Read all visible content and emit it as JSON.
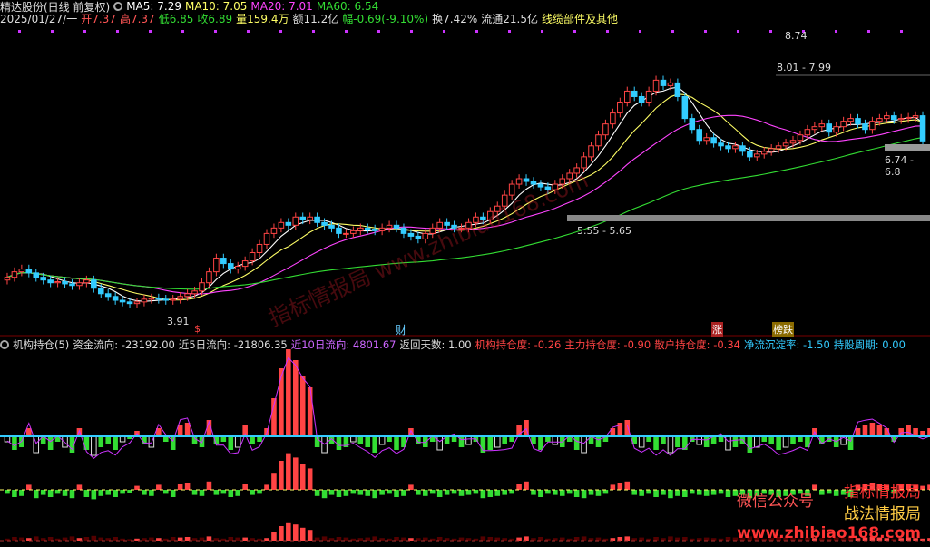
{
  "header": {
    "stock": "精达股份(日线 前复权)",
    "ma5": "MA5: 7.29",
    "ma10": "MA10: 7.05",
    "ma20": "MA20: 7.01",
    "ma60": "MA60: 6.54",
    "colors": {
      "ma5": "#ffffff",
      "ma10": "#ffff66",
      "ma20": "#ff44ff",
      "ma60": "#33dd33"
    }
  },
  "info_line": {
    "date": "2025/01/27/一",
    "open": "开7.37",
    "high": "高7.37",
    "low": "低6.85",
    "close": "收6.89",
    "volume": "量159.4万",
    "amount": "额11.2亿",
    "change": "幅-0.69(-9.10%)",
    "turnover": "换7.42%",
    "float": "流通21.5亿",
    "sector": "线缆部件及其他"
  },
  "price_annotations": {
    "high_label": "8.74",
    "range_top": "8.01 - 7.99",
    "range_mid": "6.74 - 6.8",
    "range_low": "5.55 - 5.65",
    "min_label": "3.91"
  },
  "event_markers": [
    {
      "label": "$",
      "color": "#ff4444"
    },
    {
      "label": "财",
      "color": "#66ccff"
    },
    {
      "label": "涨",
      "color": "#ffffff",
      "bg": "#aa2222"
    },
    {
      "label": "榜跌",
      "color": "#ffffff",
      "bg": "#8a6a00"
    }
  ],
  "indicator": {
    "name": "机构持仓(5)",
    "fund_flow": "资金流向: -23192.00",
    "flow5": "近5日流向: -21806.35",
    "flow10": "近10日流向: 4801.67",
    "return_days": "返回天数: 1.00",
    "inst": "机构持仓度: -0.26",
    "main": "主力持仓度: -0.90",
    "retail": "散户持仓度: -0.34",
    "settle": "净流沉淀率: -1.50",
    "period": "持股周期: 0.00",
    "colors": {
      "cyan": "#33ccff",
      "red": "#ff4444",
      "green": "#33dd33",
      "purple": "#cc33ff",
      "white": "#ffffff",
      "yellow": "#ffff66"
    }
  },
  "watermarks": {
    "diag": "指标情报局 www.zhibiao168.com",
    "wechat": "微信公众号",
    "brand1": "指标情报局",
    "brand2": "战法情报局",
    "site": "www.zhibiao168.com"
  },
  "chart_data": {
    "type": "candlestick",
    "x": [
      "d1",
      "d2",
      "d3",
      "d4",
      "d5",
      "d6",
      "d7",
      "d8",
      "d9",
      "d10",
      "d11",
      "d12",
      "d13",
      "d14",
      "d15",
      "d16",
      "d17",
      "d18",
      "d19",
      "d20",
      "d21",
      "d22",
      "d23",
      "d24",
      "d25",
      "d26",
      "d27",
      "d28",
      "d29",
      "d30",
      "d31",
      "d32",
      "d33",
      "d34",
      "d35",
      "d36",
      "d37",
      "d38",
      "d39",
      "d40",
      "d41",
      "d42",
      "d43",
      "d44",
      "d45",
      "d46",
      "d47",
      "d48",
      "d49",
      "d50",
      "d51",
      "d52",
      "d53",
      "d54",
      "d55",
      "d56",
      "d57",
      "d58",
      "d59",
      "d60",
      "d61",
      "d62",
      "d63",
      "d64",
      "d65",
      "d66",
      "d67",
      "d68",
      "d69",
      "d70",
      "d71",
      "d72",
      "d73",
      "d74",
      "d75",
      "d76",
      "d77",
      "d78",
      "d79",
      "d80",
      "d81",
      "d82",
      "d83",
      "d84",
      "d85",
      "d86",
      "d87",
      "d88",
      "d89",
      "d90",
      "d91",
      "d92",
      "d93",
      "d94",
      "d95",
      "d96",
      "d97",
      "d98",
      "d99",
      "d100",
      "d101",
      "d102",
      "d103",
      "d104",
      "d105",
      "d106",
      "d107",
      "d108",
      "d109",
      "d110",
      "d111",
      "d112",
      "d113",
      "d114",
      "d115",
      "d116",
      "d117",
      "d118",
      "d119",
      "d120",
      "d121",
      "d122",
      "d123",
      "d124",
      "d125",
      "d126",
      "d127",
      "d128"
    ],
    "close": [
      4.4,
      4.5,
      4.55,
      4.48,
      4.4,
      4.35,
      4.3,
      4.32,
      4.28,
      4.25,
      4.3,
      4.35,
      4.2,
      4.1,
      4.05,
      3.98,
      3.95,
      3.92,
      3.95,
      4.0,
      4.02,
      4.0,
      3.98,
      4.0,
      4.05,
      4.1,
      4.15,
      4.3,
      4.5,
      4.75,
      4.65,
      4.55,
      4.6,
      4.7,
      4.85,
      5.0,
      5.2,
      5.3,
      5.4,
      5.35,
      5.5,
      5.45,
      5.5,
      5.4,
      5.35,
      5.3,
      5.2,
      5.2,
      5.25,
      5.3,
      5.28,
      5.25,
      5.3,
      5.35,
      5.3,
      5.2,
      5.15,
      5.1,
      5.2,
      5.3,
      5.4,
      5.35,
      5.3,
      5.3,
      5.4,
      5.5,
      5.45,
      5.6,
      5.7,
      5.9,
      6.1,
      6.2,
      6.15,
      6.1,
      6.05,
      6.0,
      6.1,
      6.2,
      6.3,
      6.4,
      6.6,
      6.8,
      7.0,
      7.2,
      7.4,
      7.6,
      7.8,
      7.7,
      7.6,
      7.8,
      8.0,
      7.9,
      7.95,
      7.7,
      7.3,
      7.1,
      6.9,
      6.95,
      6.85,
      6.8,
      6.75,
      6.8,
      6.7,
      6.6,
      6.65,
      6.7,
      6.75,
      6.8,
      6.85,
      6.9,
      7.0,
      7.1,
      7.15,
      7.2,
      7.05,
      7.15,
      7.25,
      7.3,
      7.2,
      7.1,
      7.25,
      7.3,
      7.35,
      7.28,
      7.3,
      7.32,
      7.35,
      6.89
    ],
    "ylim": [
      3.5,
      9.0
    ],
    "volume_flow": [
      -2,
      -5,
      -4,
      3,
      -6,
      -3,
      -5,
      -2,
      -4,
      -6,
      3,
      -5,
      -7,
      -4,
      -3,
      -5,
      -2,
      -1,
      2,
      -3,
      -4,
      3,
      -2,
      -5,
      4,
      5,
      -3,
      -4,
      6,
      -3,
      -2,
      -5,
      -4,
      4,
      -3,
      -2,
      3,
      14,
      25,
      32,
      28,
      22,
      18,
      -4,
      -6,
      -3,
      -5,
      -4,
      -2,
      -3,
      -4,
      -6,
      -3,
      -2,
      -5,
      -4,
      3,
      -3,
      -4,
      -2,
      -5,
      -3,
      -2,
      -4,
      -3,
      -2,
      -6,
      -5,
      -4,
      -3,
      -2,
      4,
      6,
      -3,
      -5,
      -2,
      -3,
      -4,
      -2,
      -5,
      -6,
      -3,
      -4,
      -2,
      3,
      5,
      6,
      -3,
      -4,
      -2,
      -5,
      -3,
      -6,
      -4,
      -5,
      -2,
      -3,
      -4,
      -3,
      -2,
      -5,
      -4,
      -3,
      -6,
      -4,
      -2,
      -3,
      -5,
      -4,
      -3,
      -2,
      -4,
      3,
      -3,
      -2,
      -4,
      -3,
      -5,
      3,
      4,
      5,
      4,
      3,
      -2,
      3,
      4,
      3,
      2,
      3,
      -4
    ]
  }
}
